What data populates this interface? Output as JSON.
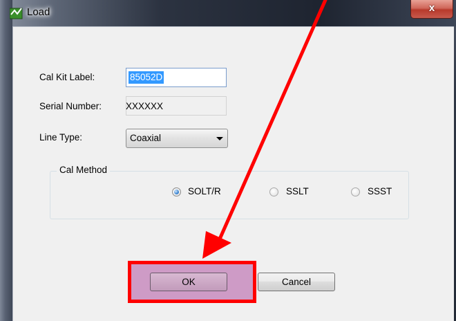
{
  "window": {
    "title": "Load",
    "close_label": "x"
  },
  "form": {
    "cal_kit_label": "Cal Kit Label:",
    "cal_kit_value": "85052D",
    "serial_label": "Serial Number:",
    "serial_value": "XXXXXX",
    "line_type_label": "Line Type:",
    "line_type_value": "Coaxial"
  },
  "cal_method": {
    "title": "Cal Method",
    "options": [
      {
        "label": "SOLT/R",
        "selected": true
      },
      {
        "label": "SSLT",
        "selected": false
      },
      {
        "label": "SSST",
        "selected": false
      }
    ]
  },
  "buttons": {
    "ok_label": "OK",
    "cancel_label": "Cancel"
  },
  "annotation": {
    "highlight_color": "#ff0000",
    "arrow_color": "#ff0000"
  }
}
